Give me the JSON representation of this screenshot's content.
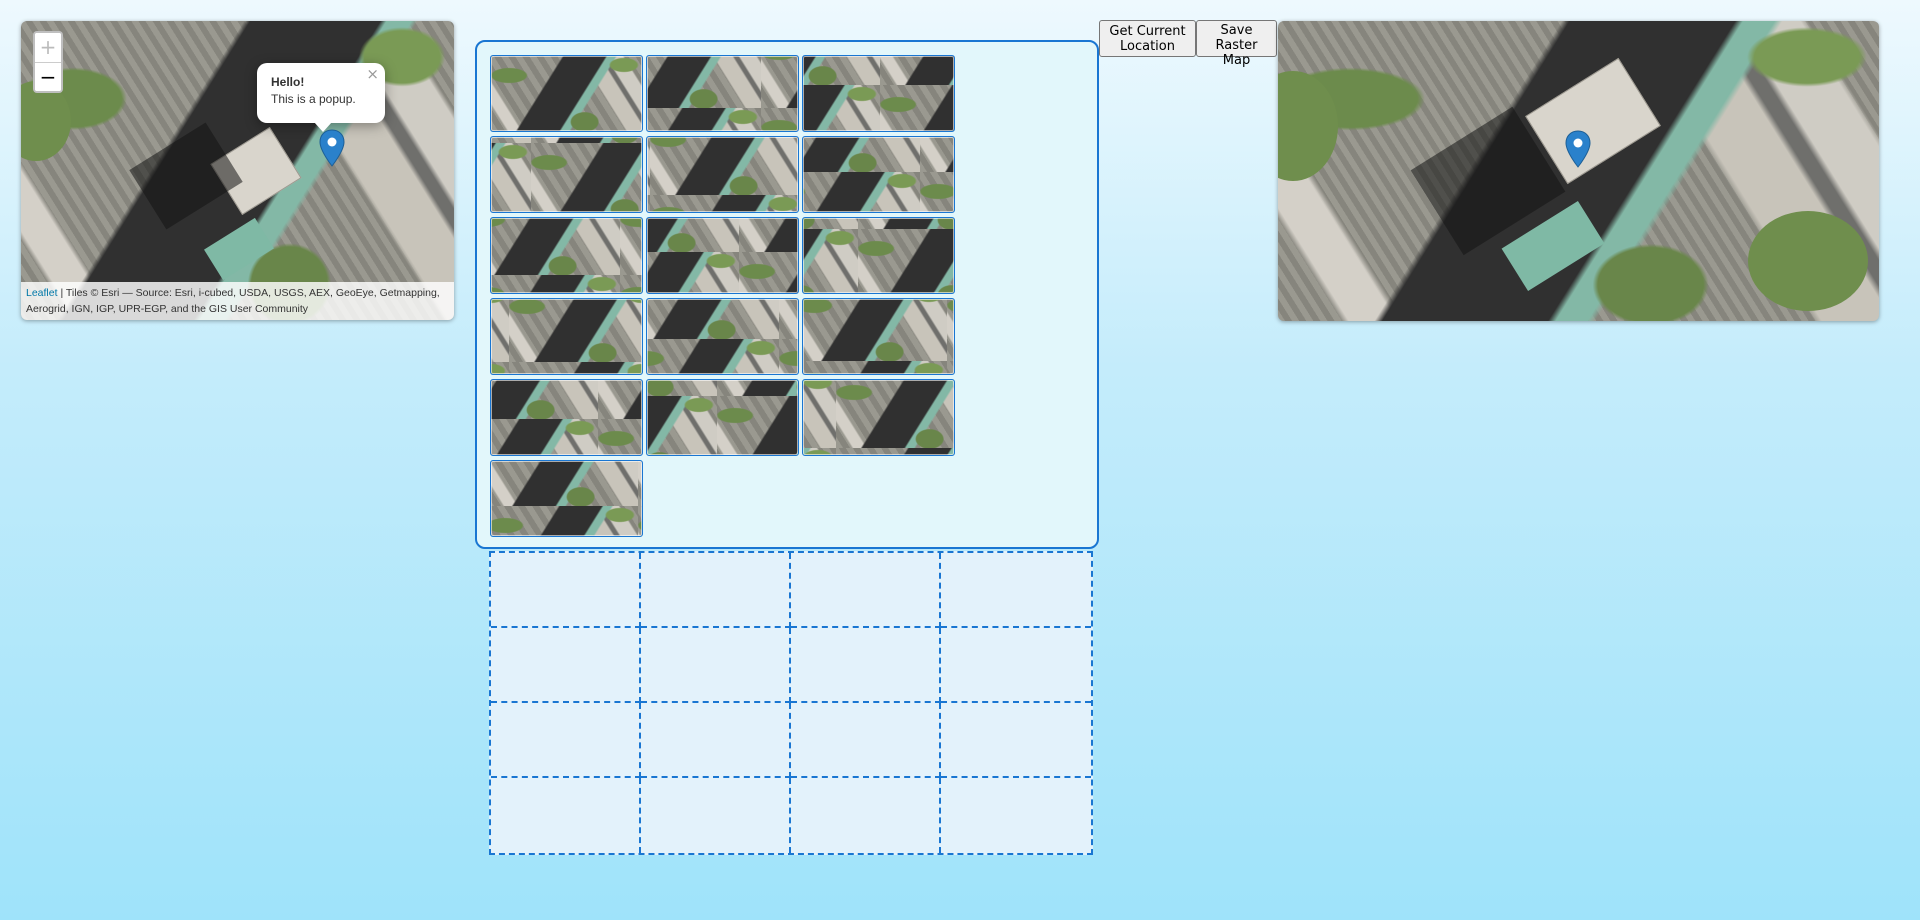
{
  "left_map": {
    "zoom_in_label": "+",
    "zoom_out_label": "−",
    "popup": {
      "title": "Hello!",
      "text": "This is a popup.",
      "close_label": "×"
    },
    "attribution": {
      "leaflet_link": "Leaflet",
      "text": " | Tiles © Esri — Source: Esri, i-cubed, USDA, USGS, AEX, GeoEye, Getmapping, Aerogrid, IGN, IGP, UPR-EGP, and the GIS User Community"
    },
    "marker_icon": "map-marker-icon"
  },
  "toolbar": {
    "get_location_label": "Get Current Location",
    "save_raster_label": "Save Raster Map"
  },
  "puzzle": {
    "piece_count": 16,
    "grid_rows": 4,
    "grid_cols": 4
  },
  "colors": {
    "accent": "#1976d2",
    "marker": "#2a81cb",
    "background_top": "#eef9fe",
    "background_bottom": "#9fe3fa"
  }
}
